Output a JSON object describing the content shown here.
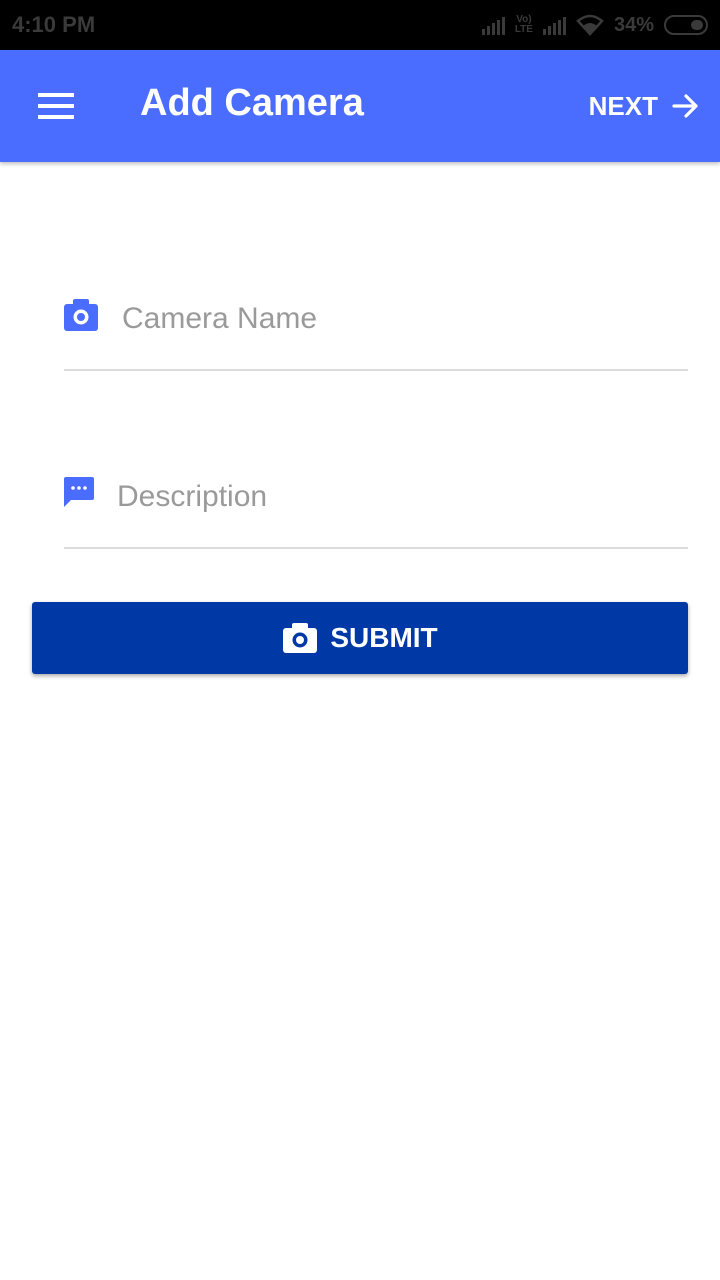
{
  "status_bar": {
    "time": "4:10 PM",
    "volte_top": "Vo)",
    "volte_bottom": "LTE",
    "battery_percent": "34%",
    "battery_level": 0.34
  },
  "app_bar": {
    "title": "Add Camera",
    "next_label": "NEXT",
    "background_color": "#4a6cff"
  },
  "form": {
    "camera_name": {
      "placeholder": "Camera Name",
      "value": "",
      "icon": "camera-icon"
    },
    "description": {
      "placeholder": "Description",
      "value": "",
      "icon": "message-icon"
    }
  },
  "submit": {
    "label": "SUBMIT",
    "icon": "camera-icon",
    "background_color": "#0039a6"
  }
}
